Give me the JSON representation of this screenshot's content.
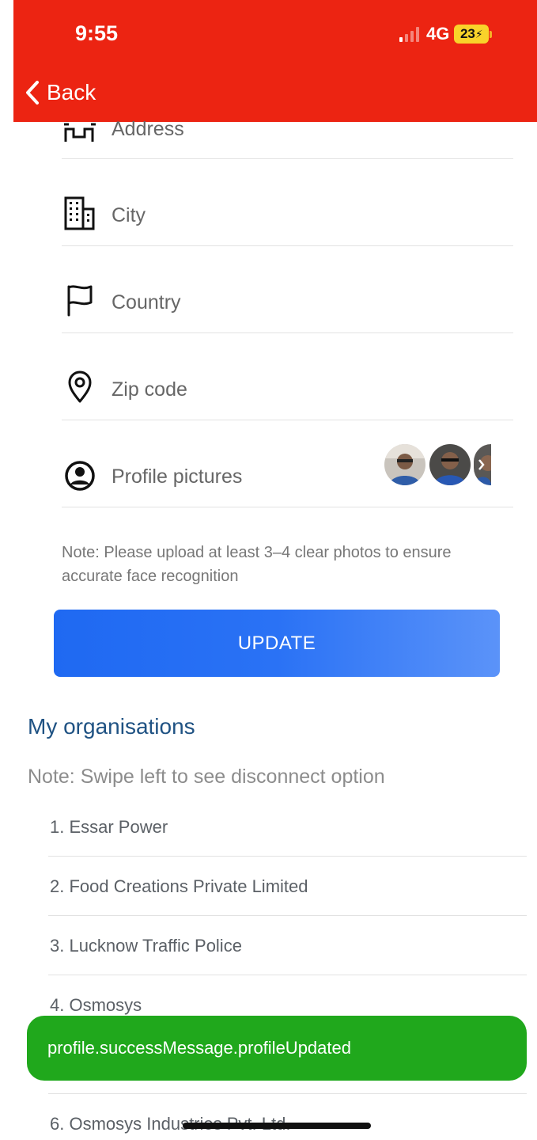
{
  "status_bar": {
    "time": "9:55",
    "network": "4G",
    "battery": "23"
  },
  "nav": {
    "back_label": "Back"
  },
  "form": {
    "address_placeholder": "Address",
    "city_placeholder": "City",
    "country_placeholder": "Country",
    "zip_placeholder": "Zip code",
    "profile_pictures_label": "Profile pictures",
    "note": "Note: Please upload at least 3–4 clear photos to ensure accurate face recognition",
    "update_label": "UPDATE"
  },
  "organisations": {
    "title": "My organisations",
    "note": "Note: Swipe left to see disconnect option",
    "items": [
      "1. Essar Power",
      "2. Food Creations Private Limited",
      "3. Lucknow Traffic Police",
      "4. Osmosys",
      "6. Osmosys Industries Pvt. Ltd."
    ]
  },
  "toast": {
    "message": "profile.successMessage.profileUpdated"
  },
  "colors": {
    "header": "#ec2412",
    "primary_button": "#1f69f2",
    "section_title": "#1f5283",
    "toast": "#20a81c",
    "battery": "#f9d32a"
  }
}
